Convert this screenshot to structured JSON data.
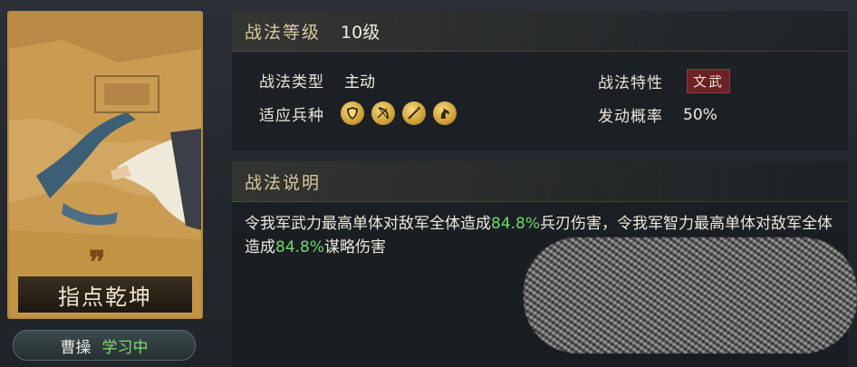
{
  "card": {
    "quote_mark": "”",
    "skill_name": "指点乾坤"
  },
  "learner": {
    "name": "曹操",
    "status": "学习中"
  },
  "level": {
    "label": "战法等级",
    "value": "10级"
  },
  "attributes": {
    "type_label": "战法类型",
    "type_value": "主动",
    "trait_label": "战法特性",
    "trait_value": "文武",
    "troops_label": "适应兵种",
    "troops": [
      "shield-icon",
      "bow-icon",
      "spear-icon",
      "horse-icon"
    ],
    "chance_label": "发动概率",
    "chance_value": "50%"
  },
  "description": {
    "label": "战法说明",
    "part1": "令我军武力最高单体对敌军全体造成",
    "pct1": "84.8%",
    "part2": "兵刃伤害，令我军智力最高单体对敌军全体造成",
    "pct2": "84.8%",
    "part3": "谋略伤害"
  },
  "colors": {
    "highlight": "#6fd86a",
    "gold_border": "#b8893b",
    "trait_tag": "#6a2226"
  }
}
